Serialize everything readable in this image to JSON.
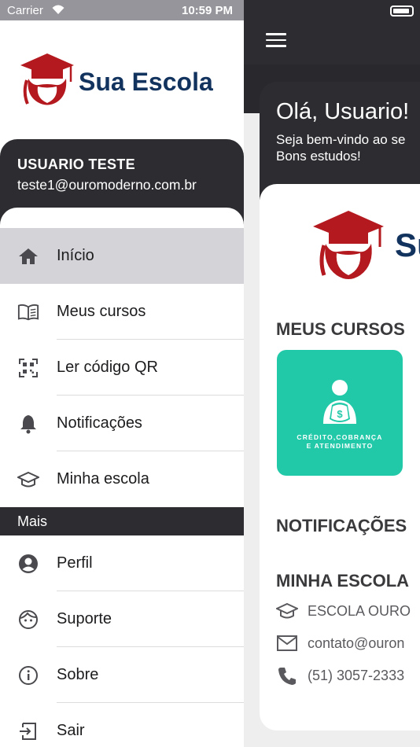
{
  "status_bar": {
    "carrier": "Carrier",
    "time": "10:59 PM"
  },
  "brand": {
    "name": "Sua Escola",
    "primary_color": "#13335f",
    "accent_color": "#b3191e"
  },
  "user": {
    "name": "USUARIO TESTE",
    "email": "teste1@ouromoderno.com.br"
  },
  "drawer": {
    "items": [
      {
        "label": "Início",
        "icon": "home-icon",
        "active": true
      },
      {
        "label": "Meus cursos",
        "icon": "book-icon"
      },
      {
        "label": "Ler código QR",
        "icon": "qr-code-icon"
      },
      {
        "label": "Notificações",
        "icon": "bell-icon"
      },
      {
        "label": "Minha escola",
        "icon": "graduation-cap-icon"
      }
    ],
    "section_more": "Mais",
    "more_items": [
      {
        "label": "Perfil",
        "icon": "person-icon"
      },
      {
        "label": "Suporte",
        "icon": "support-face-icon"
      },
      {
        "label": "Sobre",
        "icon": "info-icon"
      },
      {
        "label": "Sair",
        "icon": "logout-icon"
      }
    ]
  },
  "home": {
    "greeting": "Olá, Usuario!",
    "subtitle_line1": "Seja bem-vindo ao se",
    "subtitle_line2": "Bons estudos!",
    "logo_partial": "Su",
    "my_courses_title": "MEUS CURSOS",
    "course": {
      "name_line1": "CRÉDITO,COBRANÇA",
      "name_line2": "E ATENDIMENTO",
      "color": "#22c9a9"
    },
    "notifications_title": "NOTIFICAÇÕES",
    "my_school_title": "MINHA ESCOLA",
    "school_name": "ESCOLA OURO",
    "school_email": "contato@ouron",
    "school_phone": "(51) 3057-2333"
  }
}
